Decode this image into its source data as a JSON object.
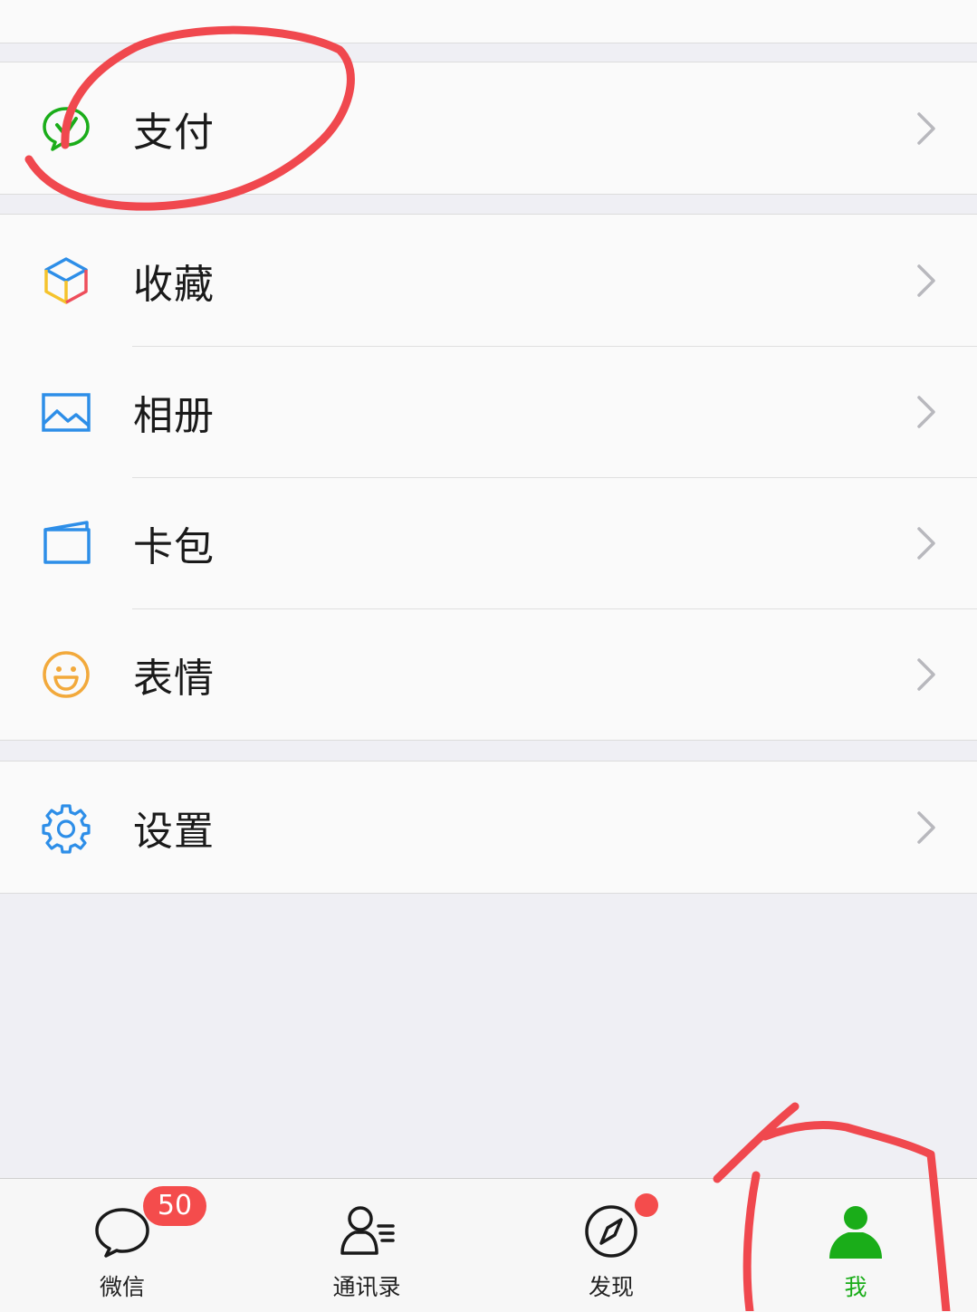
{
  "menu": {
    "pay": {
      "label": "支付",
      "icon": "wechat-pay-icon"
    },
    "favorites": {
      "label": "收藏",
      "icon": "cube-icon"
    },
    "album": {
      "label": "相册",
      "icon": "photo-icon"
    },
    "wallet": {
      "label": "卡包",
      "icon": "card-icon"
    },
    "stickers": {
      "label": "表情",
      "icon": "smile-icon"
    },
    "settings": {
      "label": "设置",
      "icon": "gear-icon"
    }
  },
  "tabbar": {
    "chats": {
      "label": "微信",
      "badge": "50",
      "icon": "chat-bubble-icon"
    },
    "contacts": {
      "label": "通讯录",
      "icon": "contacts-icon"
    },
    "discover": {
      "label": "发现",
      "icon": "compass-icon",
      "dot": true
    },
    "me": {
      "label": "我",
      "icon": "person-icon",
      "active": true
    }
  },
  "colors": {
    "accent": "#1aad19",
    "badge": "#f44c4c",
    "annotation": "#f0484e"
  }
}
